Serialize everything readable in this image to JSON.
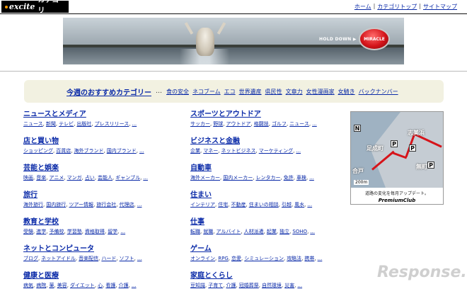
{
  "header": {
    "brand": "excite",
    "section": "カテゴリ",
    "links": [
      "ホーム",
      "カテゴリトップ",
      "サイトマップ"
    ]
  },
  "banner": {
    "hold_text": "HOLD DOWN ▶",
    "button_label": "MIRACLE"
  },
  "recommend": {
    "title": "今週のおすすめカテゴリー",
    "dots": "…",
    "items": [
      "食の安全",
      "ネコブーム",
      "エコ",
      "世界遺産",
      "県民性",
      "文章力",
      "女性漫画家",
      "女騎き",
      "バックナンバー"
    ]
  },
  "left_categories": [
    {
      "title": "ニュースとメディア",
      "subs": [
        "ニュース",
        "新聞",
        "テレビ",
        "出版社",
        "プレスリリース"
      ]
    },
    {
      "title": "店と買い物",
      "subs": [
        "ショッピング",
        "百貨店",
        "海外ブランド",
        "国内ブランド"
      ]
    },
    {
      "title": "芸能と娯楽",
      "subs": [
        "映画",
        "音楽",
        "アニメ",
        "マンガ",
        "占い",
        "芸能人",
        "ギャンブル"
      ]
    },
    {
      "title": "旅行",
      "subs": [
        "海外旅行",
        "国内旅行",
        "ツアー情報",
        "旅行会社",
        "代理店"
      ]
    },
    {
      "title": "教育と学校",
      "subs": [
        "受験",
        "進学",
        "予備校",
        "学習塾",
        "資格取得",
        "留学"
      ]
    },
    {
      "title": "ネットとコンピュータ",
      "subs": [
        "ブログ",
        "ネットアイドル",
        "音楽配信",
        "ハード",
        "ソフト"
      ]
    },
    {
      "title": "健康と医療",
      "subs": [
        "病気",
        "病院",
        "薬",
        "美容",
        "ダイエット",
        "心",
        "看護",
        "介護"
      ]
    }
  ],
  "right_categories": [
    {
      "title": "スポーツとアウトドア",
      "subs": [
        "サッカー",
        "野球",
        "アウトドア",
        "格闘技",
        "ゴルフ",
        "ニュース"
      ]
    },
    {
      "title": "ビジネスと金融",
      "subs": [
        "企業",
        "マネー",
        "ネットビジネス",
        "マーケティング"
      ]
    },
    {
      "title": "自動車",
      "subs": [
        "海外メーカー",
        "国内メーカー",
        "レンタカー",
        "免許",
        "車検"
      ]
    },
    {
      "title": "住まい",
      "subs": [
        "インテリア",
        "住宅",
        "不動産",
        "住まいの相談",
        "引越",
        "風水"
      ]
    },
    {
      "title": "仕事",
      "subs": [
        "転職",
        "就職",
        "アルバイト",
        "人材派遣",
        "起業",
        "独立",
        "SOHO"
      ]
    },
    {
      "title": "ゲーム",
      "subs": [
        "オンライン",
        "RPG",
        "恋愛",
        "シミュレーション",
        "攻略法",
        "携帯"
      ]
    },
    {
      "title": "家庭とくらし",
      "subs": [
        "豆知識",
        "子育て",
        "介護",
        "冠婚葬祭",
        "自然環境",
        "災害"
      ]
    }
  ],
  "more_label": "...",
  "map_ad": {
    "labels": [
      "志美浜",
      "足成町",
      "無町",
      "合戸"
    ],
    "parking": "P",
    "scale": "200m",
    "caption": "道路の変化を毎月アップデート。",
    "club": "PremiumClub"
  },
  "watermark": "Response."
}
